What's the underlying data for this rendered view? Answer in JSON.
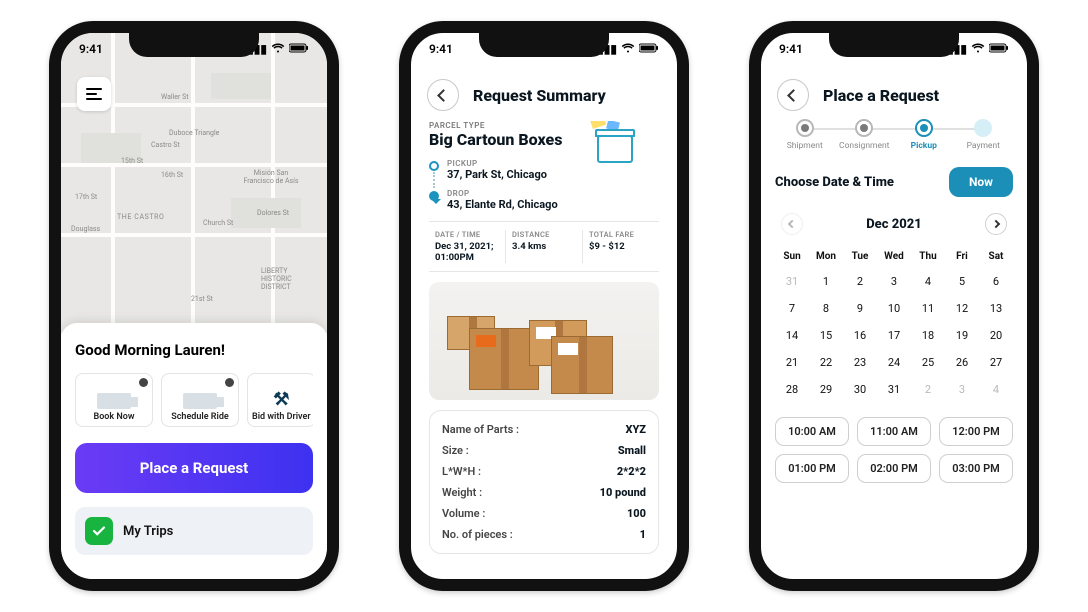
{
  "status": {
    "time": "9:41"
  },
  "screen1": {
    "greeting": "Good Morning Lauren!",
    "actions": [
      {
        "label": "Book Now"
      },
      {
        "label": "Schedule Ride"
      },
      {
        "label": "Bid with Driver"
      }
    ],
    "cta": "Place a Request",
    "trips": "My Trips",
    "map_labels": {
      "a": "Waller St",
      "b": "Duboce Triangle",
      "c": "Castro St",
      "d": "15th St",
      "e": "16th St",
      "f": "17th St",
      "g": "THE CASTRO",
      "h": "Misión San Francisco de Asís",
      "i": "Dolores St",
      "j": "Church St",
      "k": "LIBERTY HISTORIC DISTRICT",
      "l": "21st St",
      "m": "Douglass"
    }
  },
  "screen2": {
    "title": "Request Summary",
    "parcel_type_label": "PARCEL TYPE",
    "parcel_type": "Big Cartoun Boxes",
    "pickup_label": "PICKUP",
    "pickup": "37, Park St, Chicago",
    "drop_label": "DROP",
    "drop": "43, Elante Rd, Chicago",
    "meta": {
      "dt_label": "DATE / TIME",
      "dt": "Dec 31, 2021; 01:00PM",
      "dist_label": "DISTANCE",
      "dist": "3.4 kms",
      "fare_label": "TOTAL FARE",
      "fare": "$9 - $12"
    },
    "details": {
      "name_k": "Name of Parts :",
      "name_v": "XYZ",
      "size_k": "Size :",
      "size_v": "Small",
      "lwh_k": "L*W*H :",
      "lwh_v": "2*2*2",
      "weight_k": "Weight :",
      "weight_v": "10 pound",
      "volume_k": "Volume :",
      "volume_v": "100",
      "pieces_k": "No. of pieces :",
      "pieces_v": "1"
    }
  },
  "screen3": {
    "title": "Place a Request",
    "steps": [
      {
        "label": "Shipment"
      },
      {
        "label": "Consignment"
      },
      {
        "label": "Pickup"
      },
      {
        "label": "Payment"
      }
    ],
    "choose_label": "Choose Date & Time",
    "now": "Now",
    "month": "Dec 2021",
    "dow": [
      "Sun",
      "Mon",
      "Tue",
      "Wed",
      "Thu",
      "Fri",
      "Sat"
    ],
    "weeks": [
      [
        "31",
        "1",
        "2",
        "3",
        "4",
        "5",
        "6"
      ],
      [
        "7",
        "8",
        "9",
        "10",
        "11",
        "12",
        "13"
      ],
      [
        "14",
        "15",
        "16",
        "17",
        "18",
        "19",
        "20"
      ],
      [
        "21",
        "22",
        "23",
        "24",
        "25",
        "26",
        "27"
      ],
      [
        "28",
        "29",
        "30",
        "31",
        "2",
        "3",
        "4"
      ]
    ],
    "times": [
      "10:00 AM",
      "11:00 AM",
      "12:00 PM",
      "01:00 PM",
      "02:00 PM",
      "03:00 PM"
    ]
  }
}
